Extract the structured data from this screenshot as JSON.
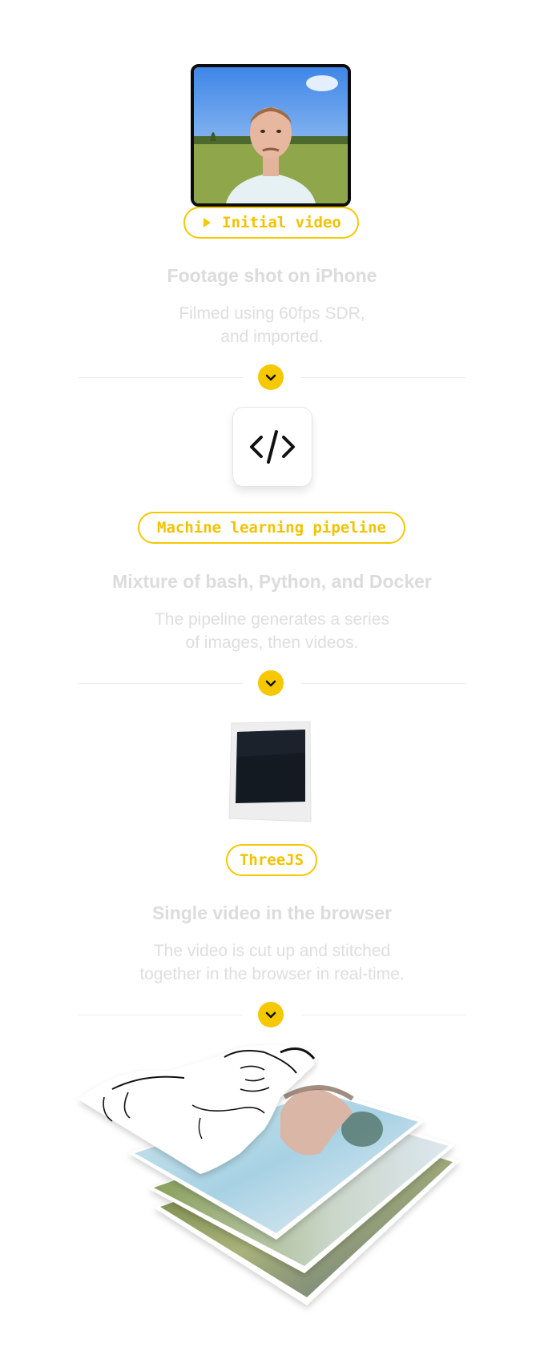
{
  "steps": [
    {
      "pill": "Initial video",
      "heading": "Footage shot on iPhone",
      "desc_line1": "Filmed using 60fps SDR,",
      "desc_line2": "and imported."
    },
    {
      "pill": "Machine learning pipeline",
      "heading": "Mixture of bash, Python, and Docker",
      "desc_line1": "The pipeline generates a series",
      "desc_line2": "of images, then videos."
    },
    {
      "pill": "ThreeJS",
      "heading": "Single video in the browser",
      "desc_line1": "The video is cut up and stitched",
      "desc_line2": "together in the browser in real-time."
    }
  ],
  "colors": {
    "accent": "#f5c800",
    "muted_text": "#dcdcdc"
  },
  "icons": [
    "play-icon",
    "chevron-down-icon",
    "code-icon"
  ]
}
